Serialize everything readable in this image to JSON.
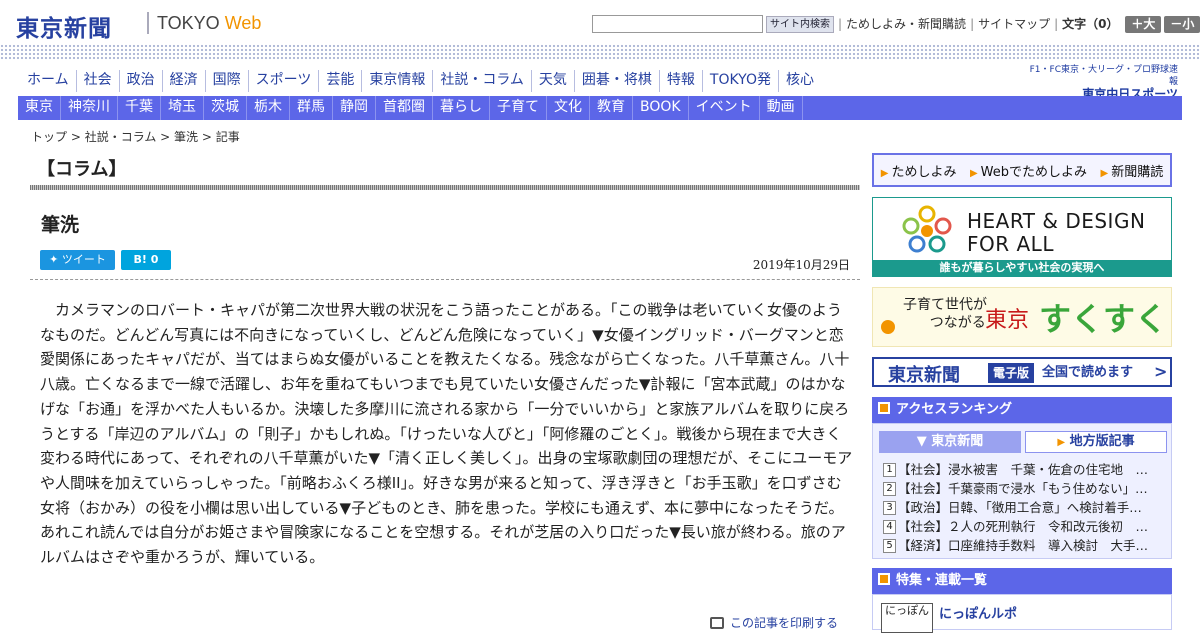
{
  "header": {
    "logo_ja": "東京新聞",
    "logo_en": "TOKYO",
    "logo_web": "Web",
    "search_button": "サイト内検索",
    "links": [
      "ためしよみ・新聞購読",
      "サイトマップ"
    ],
    "font_label": "文字（0）",
    "font_up": "＋大",
    "font_down": "－小"
  },
  "nav_main": [
    "ホーム",
    "社会",
    "政治",
    "経済",
    "国際",
    "スポーツ",
    "芸能",
    "東京情報",
    "社説・コラム",
    "天気",
    "囲碁・将棋",
    "特報",
    "TOKYO発",
    "核心"
  ],
  "chunichi": {
    "line1": "F1・FC東京・大リーグ・プロ野球速報",
    "line2": "東京中日スポーツ"
  },
  "nav_region": [
    "東京",
    "神奈川",
    "千葉",
    "埼玉",
    "茨城",
    "栃木",
    "群馬",
    "静岡",
    "首都圏",
    "暮らし",
    "子育て",
    "文化",
    "教育",
    "BOOK",
    "イベント",
    "動画"
  ],
  "breadcrumb": {
    "top": "トップ",
    "section": "社説・コラム",
    "page": "筆洗",
    "current": "記事"
  },
  "section_title": "【コラム】",
  "article": {
    "title": "筆洗",
    "tweet": "ツイート",
    "hatena": "B! 0",
    "date": "2019年10月29日",
    "body": "カメラマンのロバート・キャパが第二次世界大戦の状況をこう語ったことがある。「この戦争は老いていく女優のようなものだ。どんどん写真には不向きになっていくし、どんどん危険になっていく」▼女優イングリッド・バーグマンと恋愛関係にあったキャパだが、当てはまらぬ女優がいることを教えたくなる。残念ながら亡くなった。八千草薫さん。八十八歳。亡くなるまで一線で活躍し、お年を重ねてもいつまでも見ていたい女優さんだった▼訃報に「宮本武蔵」のはかなげな「お通」を浮かべた人もいるか。決壊した多摩川に流される家から「一分でいいから」と家族アルバムを取りに戻ろうとする「岸辺のアルバム」の「則子」かもしれぬ。「けったいな人びと」「阿修羅のごとく」。戦後から現在まで大きく変わる時代にあって、それぞれの八千草薫がいた▼「清く正しく美しく」。出身の宝塚歌劇団の理想だが、そこにユーモアや人間味を加えていらっしゃった。「前略おふくろ様II」。好きな男が来ると知って、浮き浮きと「お手玉歌」を口ずさむ女将（おかみ）の役を小欄は思い出している▼子どものとき、肺を患った。学校にも通えず、本に夢中になったそうだ。あれこれ読んでは自分がお姫さまや冒険家になることを空想する。それが芝居の入り口だった▼長い旅が終わる。旅のアルバムはさぞや重かろうが、輝いている。",
    "print": "この記事を印刷する"
  },
  "sidebar": {
    "links": [
      "ためしよみ",
      "Webでためしよみ",
      "新聞購読"
    ],
    "heart_line1": "HEART & DESIGN",
    "heart_line2": "FOR ALL",
    "heart_bar": "誰もが暮らしやすい社会の実現へ",
    "suku_line1": "子育て世代が",
    "suku_line2": "つながる",
    "suku_city": "東京",
    "suku_name": "すくすく",
    "denshi_logo": "東京新聞",
    "denshi_badge": "電子版",
    "denshi_text": "全国で読めます",
    "ranking_title": "アクセスランキング",
    "ranking_tabs": [
      "東京新聞",
      "地方版記事"
    ],
    "ranking": [
      {
        "num": "1",
        "text": "【社会】浸水被害　千葉・佐倉の住宅地　…"
      },
      {
        "num": "2",
        "text": "【社会】千葉豪雨で浸水「もう住めない」…"
      },
      {
        "num": "3",
        "text": "【政治】日韓、「徴用工合意」へ検討着手…"
      },
      {
        "num": "4",
        "text": "【社会】２人の死刑執行　令和改元後初　…"
      },
      {
        "num": "5",
        "text": "【経済】口座維持手数料　導入検討　大手…"
      }
    ],
    "feature_title": "特集・連載一覧",
    "feature_thumb": "にっぽん",
    "feature_item": "にっぽんルポ"
  },
  "colors": {
    "nav_blue": "#5c66e8",
    "brand_blue": "#2741a0",
    "orange": "#f29400",
    "teal": "#1b9a8d"
  }
}
